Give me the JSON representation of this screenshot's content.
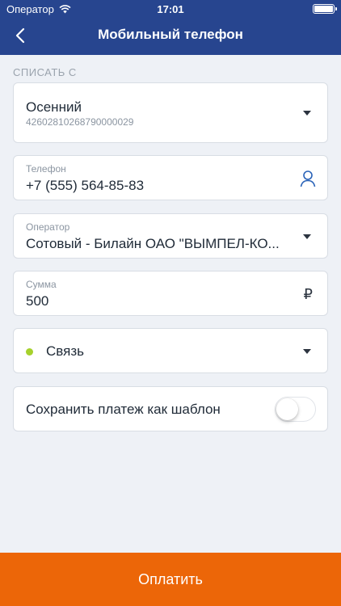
{
  "status_bar": {
    "carrier": "Оператор",
    "time": "17:01",
    "wifi_icon": "wifi-icon",
    "battery_icon": "battery-icon"
  },
  "header": {
    "title": "Мобильный телефон",
    "back_icon": "chevron-left-icon",
    "color": "#27458f"
  },
  "source": {
    "section_label": "СПИСАТЬ С",
    "account_name": "Осенний",
    "account_number": "42602810268790000029"
  },
  "phone": {
    "label": "Телефон",
    "value": "+7 (555) 564-85-83",
    "icon": "contact-person-icon"
  },
  "operator": {
    "label": "Оператор",
    "value": "Сотовый - Билайн ОАО \"ВЫМПЕЛ-КО..."
  },
  "amount": {
    "label": "Сумма",
    "value": "500",
    "currency": "₽"
  },
  "category": {
    "value": "Связь",
    "dot_color": "#a6d12c"
  },
  "template": {
    "label": "Сохранить платеж как шаблон",
    "enabled": false
  },
  "pay": {
    "label": "Оплатить",
    "color": "#ec6608"
  }
}
